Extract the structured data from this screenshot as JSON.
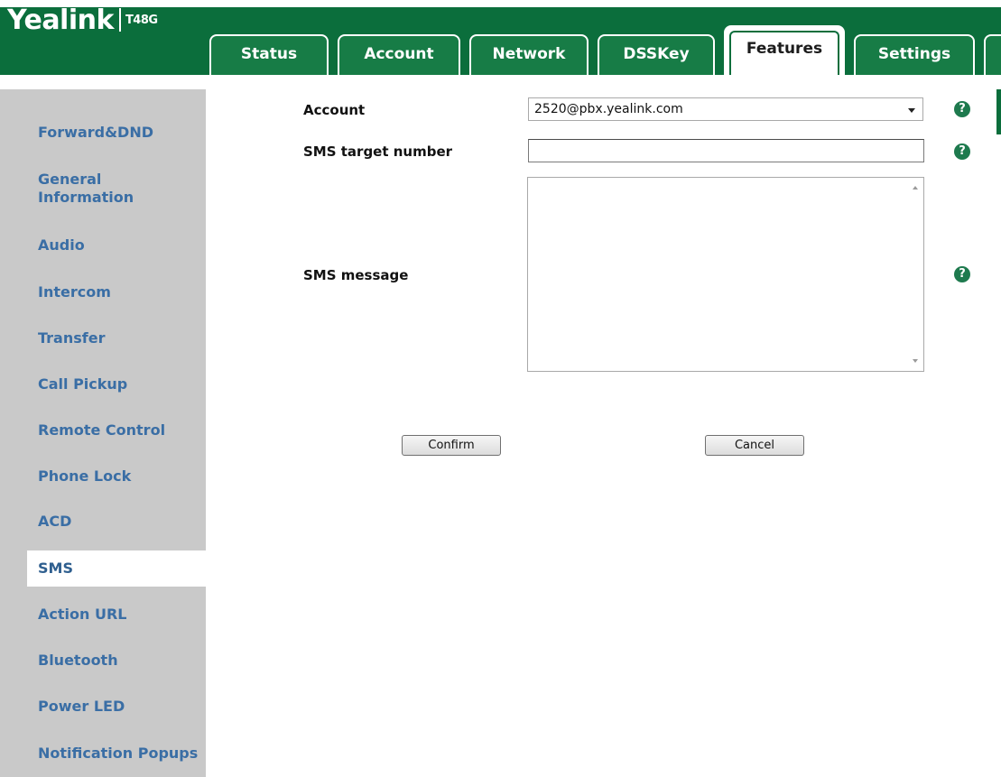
{
  "header": {
    "logo": "Yealink",
    "model": "T48G",
    "tabs": [
      {
        "label": "Status"
      },
      {
        "label": "Account"
      },
      {
        "label": "Network"
      },
      {
        "label": "DSSKey"
      },
      {
        "label": "Features",
        "active": true
      },
      {
        "label": "Settings"
      }
    ]
  },
  "sidebar": {
    "items": [
      {
        "label": "Forward&DND"
      },
      {
        "label": "General Information"
      },
      {
        "label": "Audio"
      },
      {
        "label": "Intercom"
      },
      {
        "label": "Transfer"
      },
      {
        "label": "Call Pickup"
      },
      {
        "label": "Remote Control"
      },
      {
        "label": "Phone Lock"
      },
      {
        "label": "ACD"
      },
      {
        "label": "SMS",
        "active": true
      },
      {
        "label": "Action URL"
      },
      {
        "label": "Bluetooth"
      },
      {
        "label": "Power LED"
      },
      {
        "label": "Notification Popups"
      }
    ]
  },
  "form": {
    "account_label": "Account",
    "account_value": "2520@pbx.yealink.com",
    "target_label": "SMS target number",
    "target_value": "",
    "message_label": "SMS message",
    "message_value": "",
    "help_glyph": "?",
    "confirm_label": "Confirm",
    "cancel_label": "Cancel"
  },
  "colors": {
    "brand_green": "#0b6e3c",
    "tab_green": "#177c46",
    "sidebar_bg": "#c9c9c9",
    "nav_text": "#3a6ea5"
  }
}
